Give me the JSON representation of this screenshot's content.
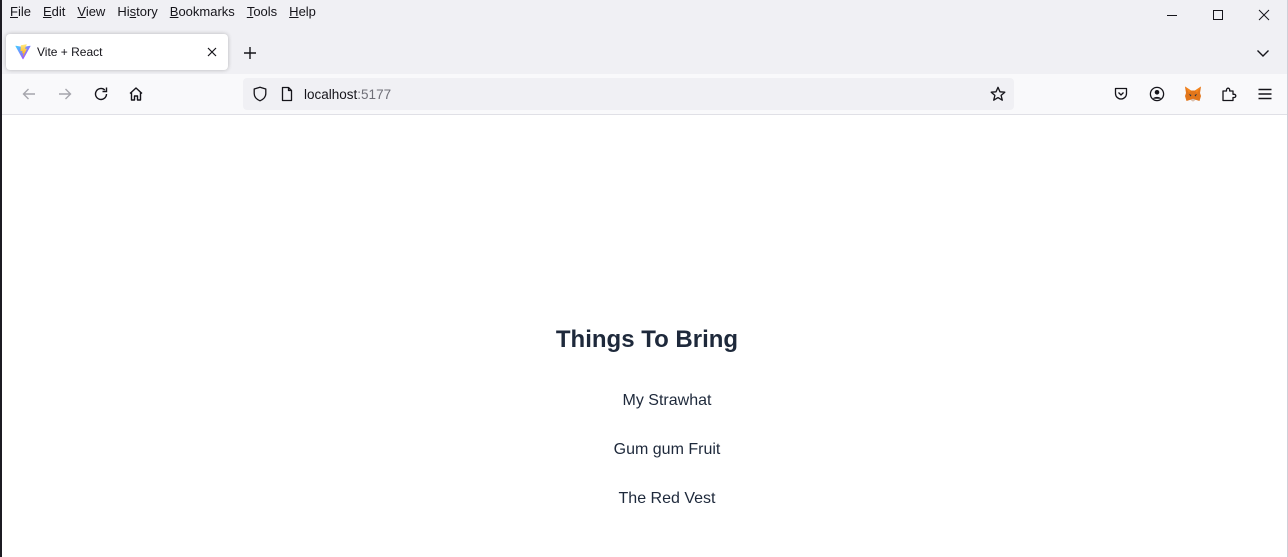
{
  "menubar": {
    "items": [
      {
        "label": "File",
        "underline": "F",
        "rest": "ile"
      },
      {
        "label": "Edit",
        "underline": "E",
        "rest": "dit"
      },
      {
        "label": "View",
        "underline": "V",
        "rest": "iew"
      },
      {
        "label": "History",
        "underline_prefix": "Hi",
        "underline": "s",
        "rest": "tory"
      },
      {
        "label": "Bookmarks",
        "underline": "B",
        "rest": "ookmarks"
      },
      {
        "label": "Tools",
        "underline": "T",
        "rest": "ools"
      },
      {
        "label": "Help",
        "underline": "H",
        "rest": "elp"
      }
    ]
  },
  "tab": {
    "title": "Vite + React",
    "favicon": "vite-logo-icon"
  },
  "urlbar": {
    "host": "localhost",
    "port": ":5177"
  },
  "page": {
    "heading": "Things To Bring",
    "items": [
      "My Strawhat",
      "Gum gum Fruit",
      "The Red Vest"
    ]
  },
  "colors": {
    "text_primary": "#1e293b",
    "chrome_bg": "#f0f0f4",
    "navbar_bg": "#f9f9fb",
    "metamask_orange": "#e2761b"
  }
}
